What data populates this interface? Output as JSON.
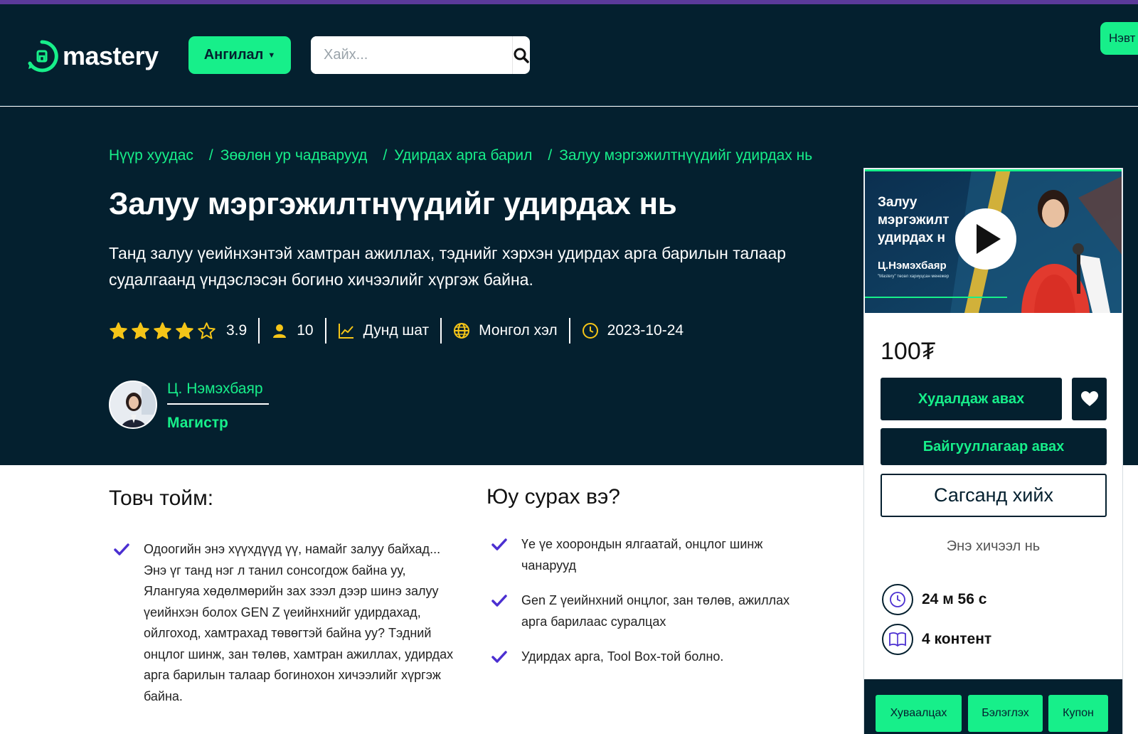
{
  "header": {
    "logo_text": "mastery",
    "category_label": "Ангилал",
    "search_placeholder": "Хайх...",
    "login_label": "Нэвт"
  },
  "breadcrumb": [
    "Нүүр хуудас",
    "Зөөлөн ур чадварууд",
    "Удирдах арга барил",
    "Залуу мэргэжилтнүүдийг удирдах нь"
  ],
  "course": {
    "title": "Залуу мэргэжилтнүүдийг удирдах нь",
    "description": "Танд залуу үеийнхэнтэй хамтран ажиллах, тэднийг хэрхэн удирдах арга барилын талаар судалгаанд үндэслэсэн богино хичээлийг хүргэж байна.",
    "rating": 3.9,
    "rating_text": "3.9",
    "students": "10",
    "level": "Дунд шат",
    "language": "Монгол хэл",
    "date": "2023-10-24"
  },
  "author": {
    "name": "Ц. Нэмэхбаяр",
    "degree": "Магистр"
  },
  "overview": {
    "heading": "Товч тойм:",
    "items": [
      "Одоогийн энэ хүүхдүүд үү, намайг залуу байхад... Энэ үг танд нэг л танил сонсогдож байна уу, Ялангуяа хөдөлмөрийн зах зээл дээр шинэ залуу үеийнхэн болох GEN Z үеийнхнийг удирдахад, ойлгоход, хамтрахад төвөгтэй байна уу? Тэдний  онцлог шинж, зан төлөв, хамтран ажиллах, удирдах арга барилын талаар богинохон хичээлийг хүргэж байна."
    ]
  },
  "learn": {
    "heading": "Юу сурах вэ?",
    "items": [
      "Үе үе хоорондын ялгаатай, онцлог шинж чанарууд",
      "Gen Z үеийнхний онцлог, зан төлөв, ажиллах арга барилаас суралцах",
      "Удирдах арга, Tool Box-той болно."
    ]
  },
  "video": {
    "title_line1": "Залуу",
    "title_line2": "мэргэжилт",
    "title_line3": "удирдах н",
    "presenter": "Ц.Нэмэхбаяр",
    "presenter_role": "\"Mastery\" төсөл хариуцсан менежер"
  },
  "card": {
    "price": "100₮",
    "buy_label": "Худалдаж авах",
    "org_label": "Байгууллагаар авах",
    "cart_label": "Сагсанд хийх",
    "includes_label": "Энэ хичээл нь",
    "duration": "24 м 56 с",
    "content_count": "4 контент",
    "share_label": "Хуваалцах",
    "gift_label": "Бэлэглэх",
    "coupon_label": "Купон"
  },
  "colors": {
    "navy": "#04202f",
    "accent_green": "#17ef8a",
    "star_yellow": "#f5c518",
    "check_purple": "#4b2fd1",
    "top_strip": "#5b3a9a"
  },
  "icons": [
    "search-icon",
    "star-icon",
    "user-icon",
    "chart-icon",
    "globe-icon",
    "clock-icon",
    "check-icon",
    "heart-icon",
    "play-icon",
    "book-icon"
  ]
}
